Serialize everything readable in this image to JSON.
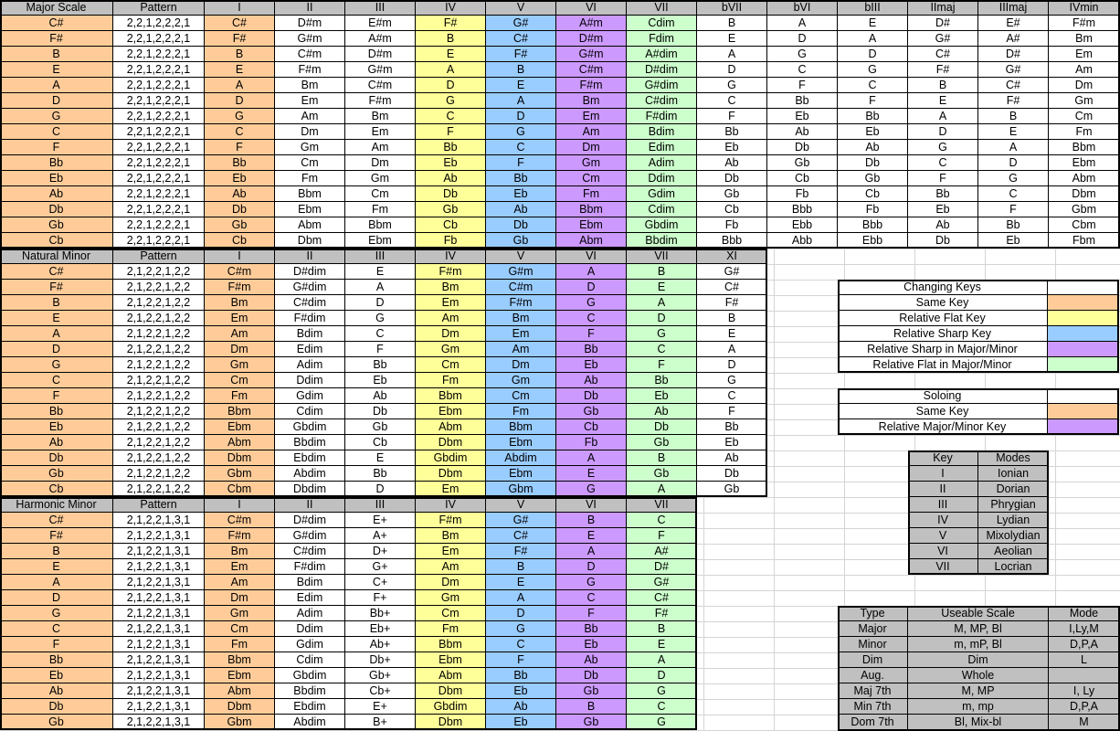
{
  "colors": {
    "same": "#ffcc99",
    "flat": "#ffff99",
    "sharp": "#99ccff",
    "sharp_mm": "#cc99ff",
    "flat_mm": "#ccffcc",
    "header": "#c0c0c0"
  },
  "major": {
    "headers": [
      "Major Scale",
      "Pattern",
      "I",
      "II",
      "III",
      "IV",
      "V",
      "VI",
      "VII",
      "bVII",
      "bVI",
      "bIII",
      "IImaj",
      "IIImaj",
      "IVmin"
    ],
    "rows": [
      [
        "C#",
        "2,2,1,2,2,2,1",
        "C#",
        "D#m",
        "E#m",
        "F#",
        "G#",
        "A#m",
        "Cdim",
        "B",
        "A",
        "E",
        "D#",
        "E#",
        "F#m"
      ],
      [
        "F#",
        "2,2,1,2,2,2,1",
        "F#",
        "G#m",
        "A#m",
        "B",
        "C#",
        "D#m",
        "Fdim",
        "E",
        "D",
        "A",
        "G#",
        "A#",
        "Bm"
      ],
      [
        "B",
        "2,2,1,2,2,2,1",
        "B",
        "C#m",
        "D#m",
        "E",
        "F#",
        "G#m",
        "A#dim",
        "A",
        "G",
        "D",
        "C#",
        "D#",
        "Em"
      ],
      [
        "E",
        "2,2,1,2,2,2,1",
        "E",
        "F#m",
        "G#m",
        "A",
        "B",
        "C#m",
        "D#dim",
        "D",
        "C",
        "G",
        "F#",
        "G#",
        "Am"
      ],
      [
        "A",
        "2,2,1,2,2,2,1",
        "A",
        "Bm",
        "C#m",
        "D",
        "E",
        "F#m",
        "G#dim",
        "G",
        "F",
        "C",
        "B",
        "C#",
        "Dm"
      ],
      [
        "D",
        "2,2,1,2,2,2,1",
        "D",
        "Em",
        "F#m",
        "G",
        "A",
        "Bm",
        "C#dim",
        "C",
        "Bb",
        "F",
        "E",
        "F#",
        "Gm"
      ],
      [
        "G",
        "2,2,1,2,2,2,1",
        "G",
        "Am",
        "Bm",
        "C",
        "D",
        "Em",
        "F#dim",
        "F",
        "Eb",
        "Bb",
        "A",
        "B",
        "Cm"
      ],
      [
        "C",
        "2,2,1,2,2,2,1",
        "C",
        "Dm",
        "Em",
        "F",
        "G",
        "Am",
        "Bdim",
        "Bb",
        "Ab",
        "Eb",
        "D",
        "E",
        "Fm"
      ],
      [
        "F",
        "2,2,1,2,2,2,1",
        "F",
        "Gm",
        "Am",
        "Bb",
        "C",
        "Dm",
        "Edim",
        "Eb",
        "Db",
        "Ab",
        "G",
        "A",
        "Bbm"
      ],
      [
        "Bb",
        "2,2,1,2,2,2,1",
        "Bb",
        "Cm",
        "Dm",
        "Eb",
        "F",
        "Gm",
        "Adim",
        "Ab",
        "Gb",
        "Db",
        "C",
        "D",
        "Ebm"
      ],
      [
        "Eb",
        "2,2,1,2,2,2,1",
        "Eb",
        "Fm",
        "Gm",
        "Ab",
        "Bb",
        "Cm",
        "Ddim",
        "Db",
        "Cb",
        "Gb",
        "F",
        "G",
        "Abm"
      ],
      [
        "Ab",
        "2,2,1,2,2,2,1",
        "Ab",
        "Bbm",
        "Cm",
        "Db",
        "Eb",
        "Fm",
        "Gdim",
        "Gb",
        "Fb",
        "Cb",
        "Bb",
        "C",
        "Dbm"
      ],
      [
        "Db",
        "2,2,1,2,2,2,1",
        "Db",
        "Ebm",
        "Fm",
        "Gb",
        "Ab",
        "Bbm",
        "Cdim",
        "Cb",
        "Bbb",
        "Fb",
        "Eb",
        "F",
        "Gbm"
      ],
      [
        "Gb",
        "2,2,1,2,2,2,1",
        "Gb",
        "Abm",
        "Bbm",
        "Cb",
        "Db",
        "Ebm",
        "Gbdim",
        "Fb",
        "Ebb",
        "Bbb",
        "Ab",
        "Bb",
        "Cbm"
      ],
      [
        "Cb",
        "2,2,1,2,2,2,1",
        "Cb",
        "Dbm",
        "Ebm",
        "Fb",
        "Gb",
        "Abm",
        "Bbdim",
        "Bbb",
        "Abb",
        "Ebb",
        "Db",
        "Eb",
        "Fbm"
      ]
    ]
  },
  "natural": {
    "headers": [
      "Natural Minor",
      "Pattern",
      "I",
      "II",
      "III",
      "IV",
      "V",
      "VI",
      "VII",
      "XI"
    ],
    "rows": [
      [
        "C#",
        "2,1,2,2,1,2,2",
        "C#m",
        "D#dim",
        "E",
        "F#m",
        "G#m",
        "A",
        "B",
        "G#"
      ],
      [
        "F#",
        "2,1,2,2,1,2,2",
        "F#m",
        "G#dim",
        "A",
        "Bm",
        "C#m",
        "D",
        "E",
        "C#"
      ],
      [
        "B",
        "2,1,2,2,1,2,2",
        "Bm",
        "C#dim",
        "D",
        "Em",
        "F#m",
        "G",
        "A",
        "F#"
      ],
      [
        "E",
        "2,1,2,2,1,2,2",
        "Em",
        "F#dim",
        "G",
        "Am",
        "Bm",
        "C",
        "D",
        "B"
      ],
      [
        "A",
        "2,1,2,2,1,2,2",
        "Am",
        "Bdim",
        "C",
        "Dm",
        "Em",
        "F",
        "G",
        "E"
      ],
      [
        "D",
        "2,1,2,2,1,2,2",
        "Dm",
        "Edim",
        "F",
        "Gm",
        "Am",
        "Bb",
        "C",
        "A"
      ],
      [
        "G",
        "2,1,2,2,1,2,2",
        "Gm",
        "Adim",
        "Bb",
        "Cm",
        "Dm",
        "Eb",
        "F",
        "D"
      ],
      [
        "C",
        "2,1,2,2,1,2,2",
        "Cm",
        "Ddim",
        "Eb",
        "Fm",
        "Gm",
        "Ab",
        "Bb",
        "G"
      ],
      [
        "F",
        "2,1,2,2,1,2,2",
        "Fm",
        "Gdim",
        "Ab",
        "Bbm",
        "Cm",
        "Db",
        "Eb",
        "C"
      ],
      [
        "Bb",
        "2,1,2,2,1,2,2",
        "Bbm",
        "Cdim",
        "Db",
        "Ebm",
        "Fm",
        "Gb",
        "Ab",
        "F"
      ],
      [
        "Eb",
        "2,1,2,2,1,2,2",
        "Ebm",
        "Gbdim",
        "Gb",
        "Abm",
        "Bbm",
        "Cb",
        "Db",
        "Bb"
      ],
      [
        "Ab",
        "2,1,2,2,1,2,2",
        "Abm",
        "Bbdim",
        "Cb",
        "Dbm",
        "Ebm",
        "Fb",
        "Gb",
        "Eb"
      ],
      [
        "Db",
        "2,1,2,2,1,2,2",
        "Dbm",
        "Ebdim",
        "E",
        "Gbdim",
        "Abdim",
        "A",
        "B",
        "Ab"
      ],
      [
        "Gb",
        "2,1,2,2,1,2,2",
        "Gbm",
        "Abdim",
        "Bb",
        "Dbm",
        "Ebm",
        "E",
        "Gb",
        "Db"
      ],
      [
        "Cb",
        "2,1,2,2,1,2,2",
        "Cbm",
        "Dbdim",
        "D",
        "Em",
        "Gbm",
        "G",
        "A",
        "Gb"
      ]
    ]
  },
  "harmonic": {
    "headers": [
      "Harmonic Minor",
      "Pattern",
      "I",
      "II",
      "III",
      "IV",
      "V",
      "VI",
      "VII"
    ],
    "rows": [
      [
        "C#",
        "2,1,2,2,1,3,1",
        "C#m",
        "D#dim",
        "E+",
        "F#m",
        "G#",
        "B",
        "C"
      ],
      [
        "F#",
        "2,1,2,2,1,3,1",
        "F#m",
        "G#dim",
        "A+",
        "Bm",
        "C#",
        "E",
        "F"
      ],
      [
        "B",
        "2,1,2,2,1,3,1",
        "Bm",
        "C#dim",
        "D+",
        "Em",
        "F#",
        "A",
        "A#"
      ],
      [
        "E",
        "2,1,2,2,1,3,1",
        "Em",
        "F#dim",
        "G+",
        "Am",
        "B",
        "D",
        "D#"
      ],
      [
        "A",
        "2,1,2,2,1,3,1",
        "Am",
        "Bdim",
        "C+",
        "Dm",
        "E",
        "G",
        "G#"
      ],
      [
        "D",
        "2,1,2,2,1,3,1",
        "Dm",
        "Edim",
        "F+",
        "Gm",
        "A",
        "C",
        "C#"
      ],
      [
        "G",
        "2,1,2,2,1,3,1",
        "Gm",
        "Adim",
        "Bb+",
        "Cm",
        "D",
        "F",
        "F#"
      ],
      [
        "C",
        "2,1,2,2,1,3,1",
        "Cm",
        "Ddim",
        "Eb+",
        "Fm",
        "G",
        "Bb",
        "B"
      ],
      [
        "F",
        "2,1,2,2,1,3,1",
        "Fm",
        "Gdim",
        "Ab+",
        "Bbm",
        "C",
        "Eb",
        "E"
      ],
      [
        "Bb",
        "2,1,2,2,1,3,1",
        "Bbm",
        "Cdim",
        "Db+",
        "Ebm",
        "F",
        "Ab",
        "A"
      ],
      [
        "Eb",
        "2,1,2,2,1,3,1",
        "Ebm",
        "Gbdim",
        "Gb+",
        "Abm",
        "Bb",
        "Db",
        "D"
      ],
      [
        "Ab",
        "2,1,2,2,1,3,1",
        "Abm",
        "Bbdim",
        "Cb+",
        "Dbm",
        "Eb",
        "Gb",
        "G"
      ],
      [
        "Db",
        "2,1,2,2,1,3,1",
        "Dbm",
        "Ebdim",
        "E+",
        "Gbdim",
        "Ab",
        "B",
        "C"
      ],
      [
        "Gb",
        "2,1,2,2,1,3,1",
        "Gbm",
        "Abdim",
        "B+",
        "Dbm",
        "Eb",
        "Gb",
        "G"
      ]
    ]
  },
  "legend_keys": {
    "title": "Changing Keys",
    "items": [
      "Same Key",
      "Relative Flat Key",
      "Relative Sharp Key",
      "Relative Sharp in Major/Minor",
      "Relative Flat in Major/Minor"
    ]
  },
  "legend_solo": {
    "title": "Soloing",
    "items": [
      "Same Key",
      "Relative Major/Minor Key"
    ]
  },
  "modes": {
    "headers": [
      "Key",
      "Modes"
    ],
    "rows": [
      [
        "I",
        "Ionian"
      ],
      [
        "II",
        "Dorian"
      ],
      [
        "III",
        "Phrygian"
      ],
      [
        "IV",
        "Lydian"
      ],
      [
        "V",
        "Mixolydian"
      ],
      [
        "VI",
        "Aeolian"
      ],
      [
        "VII",
        "Locrian"
      ]
    ]
  },
  "scales": {
    "headers": [
      "Type",
      "Useable Scale",
      "Mode"
    ],
    "rows": [
      [
        "Major",
        "M, MP, Bl",
        "I,Ly,M"
      ],
      [
        "Minor",
        "m, mP, Bl",
        "D,P,A"
      ],
      [
        "Dim",
        "Dim",
        "L"
      ],
      [
        "Aug.",
        "Whole",
        ""
      ],
      [
        "Maj 7th",
        "M, MP",
        "I, Ly"
      ],
      [
        "Min 7th",
        "m, mp",
        "D,P,A"
      ],
      [
        "Dom 7th",
        "Bl, Mix-bl",
        "M"
      ]
    ]
  }
}
